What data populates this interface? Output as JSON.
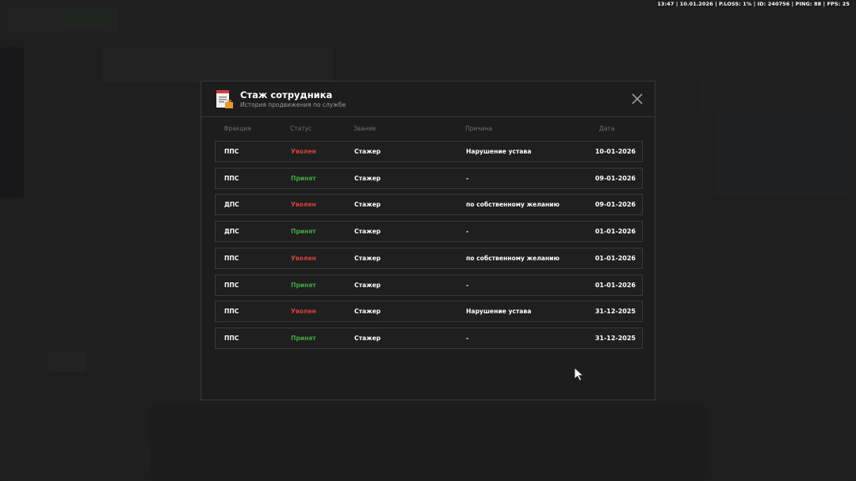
{
  "status_bar": "13:47 | 10.01.2026 | P.LOSS: 1% | ID: 240756 | PING: 88 | FPS: 25",
  "modal": {
    "title": "Стаж сотрудника",
    "subtitle": "История продвижения по службе",
    "icon": "document-icon",
    "close_icon": "close-icon"
  },
  "columns": {
    "faction": "Фракция",
    "status": "Статус",
    "rank": "Звание",
    "reason": "Причина",
    "date": "Дата"
  },
  "colors": {
    "fired": "#d9403f",
    "hired": "#3fa940"
  },
  "rows": [
    {
      "faction": "ППС",
      "status": "Уволен",
      "rank": "Стажер",
      "reason": "Нарушение устава",
      "date": "10-01-2026"
    },
    {
      "faction": "ППС",
      "status": "Принят",
      "rank": "Стажер",
      "reason": "-",
      "date": "09-01-2026"
    },
    {
      "faction": "ДПС",
      "status": "Уволен",
      "rank": "Стажер",
      "reason": "по собственному желанию",
      "date": "09-01-2026"
    },
    {
      "faction": "ДПС",
      "status": "Принят",
      "rank": "Стажер",
      "reason": "-",
      "date": "01-01-2026"
    },
    {
      "faction": "ППС",
      "status": "Уволен",
      "rank": "Стажер",
      "reason": "по собственному желанию",
      "date": "01-01-2026"
    },
    {
      "faction": "ППС",
      "status": "Принят",
      "rank": "Стажер",
      "reason": "-",
      "date": "01-01-2026"
    },
    {
      "faction": "ППС",
      "status": "Уволен",
      "rank": "Стажер",
      "reason": "Нарушение устава",
      "date": "31-12-2025"
    },
    {
      "faction": "ППС",
      "status": "Принят",
      "rank": "Стажер",
      "reason": "-",
      "date": "31-12-2025"
    }
  ]
}
